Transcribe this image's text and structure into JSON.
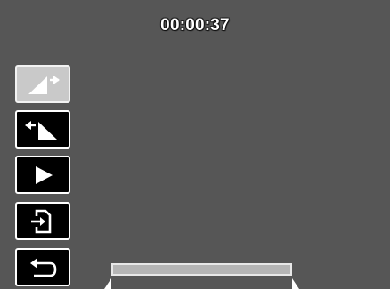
{
  "player": {
    "timecode": "00:00:37"
  },
  "controls": [
    {
      "name": "trim-end-button",
      "icon": "trim-end-icon",
      "selected": true
    },
    {
      "name": "trim-start-button",
      "icon": "trim-start-icon",
      "selected": false
    },
    {
      "name": "play-button",
      "icon": "play-icon",
      "selected": false
    },
    {
      "name": "save-button",
      "icon": "save-icon",
      "selected": false
    },
    {
      "name": "back-button",
      "icon": "back-icon",
      "selected": false
    }
  ],
  "timeline": {
    "progress": 1.0
  },
  "colors": {
    "background": "#565656",
    "button_bg": "#000000",
    "button_border": "#ffffff",
    "selected_bg": "#c9c9c9",
    "text": "#ffffff"
  }
}
